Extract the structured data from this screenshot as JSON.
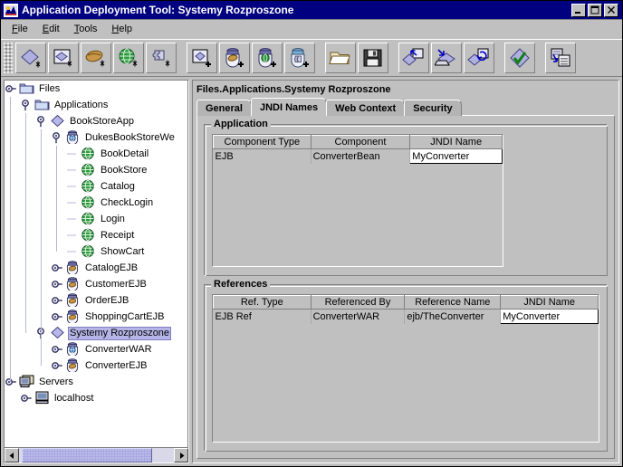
{
  "window": {
    "title": "Application Deployment Tool: Systemy Rozproszone",
    "icon": "app-icon",
    "buttons": {
      "minimize": "minimize-button",
      "maximize": "maximize-button",
      "close": "close-button"
    }
  },
  "menubar": {
    "items": [
      {
        "label": "File",
        "mnemonic": "F"
      },
      {
        "label": "Edit",
        "mnemonic": "E"
      },
      {
        "label": "Tools",
        "mnemonic": "T"
      },
      {
        "label": "Help",
        "mnemonic": "H"
      }
    ]
  },
  "toolbar": {
    "groups": [
      {
        "buttons": [
          {
            "name": "new-application-icon",
            "tooltip": "New Application"
          },
          {
            "name": "new-web-component-icon",
            "tooltip": "New Web Component"
          },
          {
            "name": "new-ejb-icon",
            "tooltip": "New Enterprise Bean"
          },
          {
            "name": "new-web-app-icon",
            "tooltip": "New Web Application"
          },
          {
            "name": "new-app-client-icon",
            "tooltip": "New Application Client"
          }
        ]
      },
      {
        "buttons": [
          {
            "name": "add-application-icon",
            "tooltip": "Add Application"
          },
          {
            "name": "add-ejb-jar-icon",
            "tooltip": "Add EJB JAR"
          },
          {
            "name": "add-web-war-icon",
            "tooltip": "Add Web WAR"
          },
          {
            "name": "add-client-jar-icon",
            "tooltip": "Add Client JAR"
          }
        ]
      },
      {
        "buttons": [
          {
            "name": "open-folder-icon",
            "tooltip": "Open"
          },
          {
            "name": "save-floppy-icon",
            "tooltip": "Save"
          }
        ]
      },
      {
        "buttons": [
          {
            "name": "deploy-icon",
            "tooltip": "Deploy"
          },
          {
            "name": "undeploy-icon",
            "tooltip": "Undeploy"
          },
          {
            "name": "redeploy-icon",
            "tooltip": "Redeploy"
          }
        ]
      },
      {
        "buttons": [
          {
            "name": "verify-check-icon",
            "tooltip": "Verifier"
          }
        ]
      },
      {
        "buttons": [
          {
            "name": "generate-sql-icon",
            "tooltip": "Generate SQL"
          }
        ]
      }
    ]
  },
  "tree": {
    "nodes": [
      {
        "label": "Files",
        "depth": 0,
        "icon": "folder-icon",
        "handle": "collapsed",
        "selected": false
      },
      {
        "label": "Applications",
        "depth": 1,
        "icon": "folder-icon",
        "handle": "expanded",
        "selected": false
      },
      {
        "label": "BookStoreApp",
        "depth": 2,
        "icon": "diamond-icon",
        "handle": "expanded",
        "selected": false
      },
      {
        "label": "DukesBookStoreWe",
        "depth": 3,
        "icon": "war-icon",
        "handle": "expanded",
        "selected": false
      },
      {
        "label": "BookDetail",
        "depth": 4,
        "icon": "globe-icon",
        "handle": "leaf",
        "selected": false
      },
      {
        "label": "BookStore",
        "depth": 4,
        "icon": "globe-icon",
        "handle": "leaf",
        "selected": false
      },
      {
        "label": "Catalog",
        "depth": 4,
        "icon": "globe-icon",
        "handle": "leaf",
        "selected": false
      },
      {
        "label": "CheckLogin",
        "depth": 4,
        "icon": "globe-icon",
        "handle": "leaf",
        "selected": false
      },
      {
        "label": "Login",
        "depth": 4,
        "icon": "globe-icon",
        "handle": "leaf",
        "selected": false
      },
      {
        "label": "Receipt",
        "depth": 4,
        "icon": "globe-icon",
        "handle": "leaf",
        "selected": false
      },
      {
        "label": "ShowCart",
        "depth": 4,
        "icon": "globe-icon",
        "handle": "leaf",
        "selected": false
      },
      {
        "label": "CatalogEJB",
        "depth": 3,
        "icon": "ejb-icon",
        "handle": "collapsed",
        "selected": false
      },
      {
        "label": "CustomerEJB",
        "depth": 3,
        "icon": "ejb-icon",
        "handle": "collapsed",
        "selected": false
      },
      {
        "label": "OrderEJB",
        "depth": 3,
        "icon": "ejb-icon",
        "handle": "collapsed",
        "selected": false
      },
      {
        "label": "ShoppingCartEJB",
        "depth": 3,
        "icon": "ejb-icon",
        "handle": "collapsed",
        "selected": false
      },
      {
        "label": "Systemy Rozproszone",
        "depth": 2,
        "icon": "diamond-icon",
        "handle": "expanded",
        "selected": true
      },
      {
        "label": "ConverterWAR",
        "depth": 3,
        "icon": "war-icon",
        "handle": "collapsed",
        "selected": false
      },
      {
        "label": "ConverterEJB",
        "depth": 3,
        "icon": "ejb-icon",
        "handle": "collapsed",
        "selected": false
      },
      {
        "label": "Servers",
        "depth": 0,
        "icon": "server-icon",
        "handle": "collapsed",
        "selected": false
      },
      {
        "label": "localhost",
        "depth": 1,
        "icon": "computer-icon",
        "handle": "collapsed",
        "selected": false
      }
    ],
    "scrollbar": {
      "left_arrow": "scroll-left-arrow-icon",
      "right_arrow": "scroll-right-arrow-icon"
    }
  },
  "main": {
    "breadcrumb": "Files.Applications.Systemy Rozproszone",
    "tabs": [
      {
        "label": "General",
        "active": false
      },
      {
        "label": "JNDI Names",
        "active": true
      },
      {
        "label": "Web Context",
        "active": false
      },
      {
        "label": "Security",
        "active": false
      }
    ],
    "application_group": {
      "title": "Application",
      "columns": [
        "Component Type",
        "Component",
        "JNDI Name"
      ],
      "rows": [
        {
          "cells": [
            "EJB",
            "ConverterBean",
            "MyConverter"
          ],
          "editing_column": 2
        }
      ]
    },
    "references_group": {
      "title": "References",
      "columns": [
        "Ref. Type",
        "Referenced By",
        "Reference Name",
        "JNDI Name"
      ],
      "rows": [
        {
          "cells": [
            "EJB Ref",
            "ConverterWAR",
            "ejb/TheConverter",
            "MyConverter"
          ],
          "editing_column": 3
        }
      ]
    }
  },
  "colors": {
    "titlebar": "#000080",
    "face": "#c0c0c0",
    "selection": "#b4b4e6",
    "field": "#ffffff",
    "text": "#000000"
  }
}
